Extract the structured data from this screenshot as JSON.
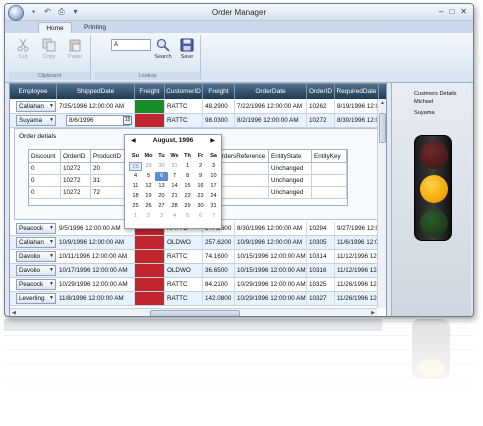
{
  "window": {
    "title": "Order Manager",
    "quick_access_icons": [
      "save-icon",
      "undo-icon",
      "print-icon",
      "dropdown-icon"
    ],
    "controls": [
      "minimize-icon",
      "maximize-icon",
      "close-icon"
    ]
  },
  "ribbon": {
    "tabs": [
      {
        "label": "Home",
        "selected": true
      },
      {
        "label": "Printing",
        "selected": false
      }
    ],
    "clipboard": {
      "label": "Clipboard",
      "cut": "Cut",
      "copy": "Copy",
      "paste": "Paste"
    },
    "lookup": {
      "label": "Lookup",
      "input_value": "A",
      "search": "Search",
      "save": "Save"
    }
  },
  "grid": {
    "columns": [
      "Employee",
      "ShippedDate",
      "Freight",
      "CustomerID",
      "Freight",
      "OrderDate",
      "OrderID",
      "RequiredDate"
    ],
    "rows_top": [
      {
        "employee": "Callahan",
        "shipped": "7/25/1996 12:00:00 AM",
        "freight": "",
        "customer": "RATTC",
        "freight2": "48.2900",
        "order_date": "7/22/1996 12:00:00 AM",
        "order_id": "10262",
        "required": "8/19/1996 12:00"
      },
      {
        "employee": "Suyama",
        "shipped": "8/6/1996",
        "freight": "",
        "customer": "RATTC",
        "freight2": "98.0300",
        "order_date": "8/2/1996 12:00:00 AM",
        "order_id": "10272",
        "required": "8/30/1996 12:00"
      }
    ],
    "details": {
      "title": "Order detials",
      "columns": [
        "Discount",
        "OrderID",
        "ProductID",
        "OrdersReference",
        "EntityState",
        "EntityKey"
      ],
      "rows": [
        {
          "discount": "0",
          "order_id": "10272",
          "product_id": "20",
          "state": "Unchanged"
        },
        {
          "discount": "0",
          "order_id": "10272",
          "product_id": "31",
          "state": "Unchanged"
        },
        {
          "discount": "0",
          "order_id": "10272",
          "product_id": "72",
          "state": "Unchanged"
        }
      ]
    },
    "rows_bottom": [
      {
        "employee": "Peacock",
        "shipped": "9/5/1996 12:00:00 AM",
        "freight": "",
        "customer": "RATTC",
        "freight2": "147.2600",
        "order_date": "8/30/1996 12:00:00 AM",
        "order_id": "10294",
        "required": "9/27/1996 12:00"
      },
      {
        "employee": "Callahan",
        "shipped": "10/9/1996 12:00:00 AM",
        "freight": "",
        "customer": "OLDWO",
        "freight2": "257.6200",
        "order_date": "10/9/1996 12:00:00 AM",
        "order_id": "10305",
        "required": "11/6/1996 12:00"
      },
      {
        "employee": "Davolio",
        "shipped": "10/11/1996 12:00:00 AM",
        "freight": "",
        "customer": "RATTC",
        "freight2": "74.1600",
        "order_date": "10/15/1996 12:00:00 AM",
        "order_id": "10314",
        "required": "11/12/1996 12:00"
      },
      {
        "employee": "Davolio",
        "shipped": "10/17/1996 12:00:00 AM",
        "freight": "",
        "customer": "OLDWO",
        "freight2": "36.6500",
        "order_date": "10/15/1996 12:00:00 AM",
        "order_id": "10316",
        "required": "11/12/1996 12:00"
      },
      {
        "employee": "Peacock",
        "shipped": "10/29/1996 12:00:00 AM",
        "freight": "",
        "customer": "RATTC",
        "freight2": "84.2100",
        "order_date": "10/29/1996 12:00:00 AM",
        "order_id": "10325",
        "required": "11/26/1996 12:00"
      },
      {
        "employee": "Leverling",
        "shipped": "11/8/1996 12:00:00 AM",
        "freight": "",
        "customer": "RATTC",
        "freight2": "142.0800",
        "order_date": "10/29/1996 12:00:00 AM",
        "order_id": "10327",
        "required": "11/26/1996 12:00"
      }
    ]
  },
  "calendar": {
    "month": "August, 1996",
    "prev": "◀",
    "next": "▶",
    "days_of_week": [
      "Su",
      "Mo",
      "Tu",
      "We",
      "Th",
      "Fr",
      "Sa"
    ],
    "weeks": [
      [
        "28",
        "29",
        "30",
        "31",
        "1",
        "2",
        "3"
      ],
      [
        "4",
        "5",
        "6",
        "7",
        "8",
        "9",
        "10"
      ],
      [
        "11",
        "12",
        "13",
        "14",
        "15",
        "16",
        "17"
      ],
      [
        "18",
        "19",
        "20",
        "21",
        "22",
        "23",
        "24"
      ],
      [
        "25",
        "26",
        "27",
        "28",
        "29",
        "30",
        "31"
      ],
      [
        "1",
        "2",
        "3",
        "4",
        "5",
        "6",
        "7"
      ]
    ],
    "calendar_button": "15"
  },
  "customer_panel": {
    "label": "Custmers Details",
    "first_name": "Michael",
    "last_name": "Suyama"
  },
  "colors": {
    "freight_red": "#c0262b",
    "freight_green": "#1a8d2a",
    "traffic_amber": "#f2a400"
  }
}
